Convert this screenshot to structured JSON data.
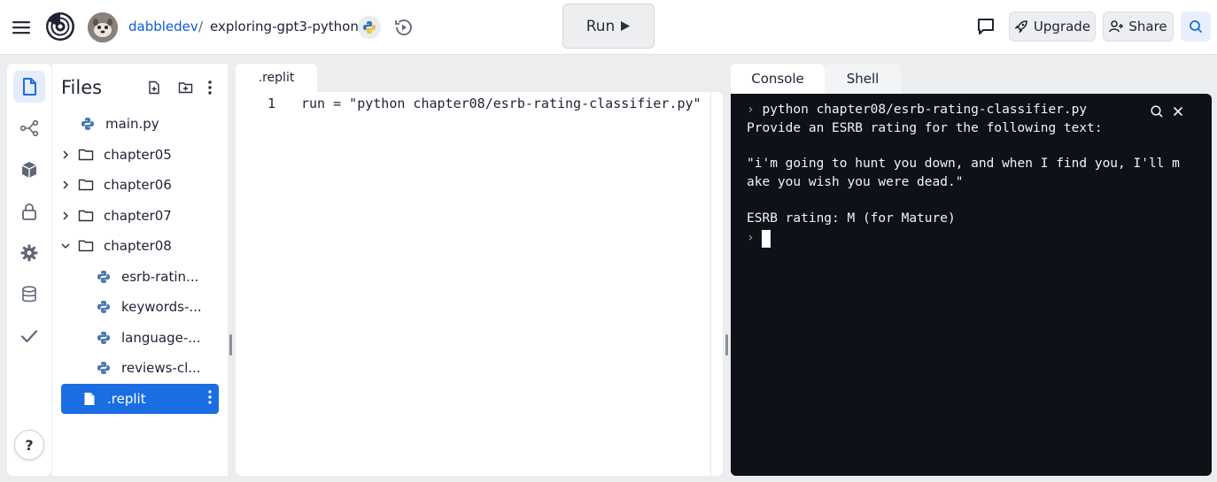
{
  "header": {
    "owner": "dabbledev",
    "separator": "/",
    "repo_name": "exploring-gpt3-python",
    "run_label": "Run",
    "upgrade_label": "Upgrade",
    "share_label": "Share",
    "icons": [
      "menu-icon",
      "replit-logo-icon",
      "avatar",
      "python-icon",
      "history-icon",
      "play-icon",
      "chat-icon",
      "rocket-icon",
      "add-user-icon",
      "search-icon"
    ]
  },
  "rail": {
    "items": [
      "files-icon",
      "git-branch-icon",
      "packages-icon",
      "lock-icon",
      "gear-icon",
      "database-icon",
      "check-icon"
    ],
    "help_label": "?"
  },
  "files": {
    "title": "Files",
    "tree": [
      {
        "label": "main.py",
        "type": "python"
      },
      {
        "label": "chapter05",
        "type": "folder",
        "expanded": false
      },
      {
        "label": "chapter06",
        "type": "folder",
        "expanded": false
      },
      {
        "label": "chapter07",
        "type": "folder",
        "expanded": false
      },
      {
        "label": "chapter08",
        "type": "folder",
        "expanded": true
      },
      {
        "label": "esrb-ratin...",
        "type": "python"
      },
      {
        "label": "keywords-...",
        "type": "python"
      },
      {
        "label": "language-...",
        "type": "python"
      },
      {
        "label": "reviews-cl...",
        "type": "python"
      },
      {
        "label": ".replit",
        "type": "file",
        "selected": true
      }
    ]
  },
  "editor": {
    "tab_label": ".replit",
    "line_number": "1",
    "code_line": "run = \"python chapter08/esrb-rating-classifier.py\""
  },
  "console": {
    "tab_console": "Console",
    "tab_shell": "Shell",
    "prompt": "›",
    "command": "python chapter08/esrb-rating-classifier.py",
    "lines": [
      "Provide an ESRB rating for the following text:",
      "",
      "\"i'm going to hunt you down, and when I find you, I'll m",
      "ake you wish you were dead.\"",
      "",
      "ESRB rating: M (for Mature)"
    ]
  },
  "colors": {
    "accent": "#1a6ee2",
    "console_bg": "#0e1117",
    "owner_link": "#0f5bd5"
  }
}
